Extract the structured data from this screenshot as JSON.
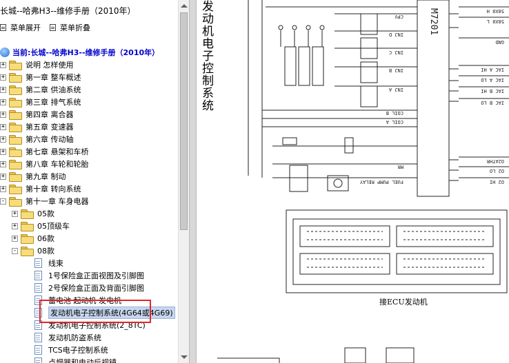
{
  "window": {
    "title": "长城--哈弗H3--维修手册（2010年）"
  },
  "toolbar": {
    "expand_label": "菜单展开",
    "collapse_label": "菜单折叠"
  },
  "tree": {
    "root": "当前:长城--哈弗H3--维修手册（2010年）",
    "items": [
      {
        "label": "说明 怎样使用",
        "expander": "+"
      },
      {
        "label": "第一章 整车概述",
        "expander": "+"
      },
      {
        "label": "第二章 供油系统",
        "expander": "+"
      },
      {
        "label": "第三章 排气系统",
        "expander": "+"
      },
      {
        "label": "第四章 离合器",
        "expander": "+"
      },
      {
        "label": "第五章 变速器",
        "expander": "+"
      },
      {
        "label": "第六章 传动轴",
        "expander": "+"
      },
      {
        "label": "第七章 悬架和车桥",
        "expander": "+"
      },
      {
        "label": "第八章 车轮和轮胎",
        "expander": "+"
      },
      {
        "label": "第九章 制动",
        "expander": "+"
      },
      {
        "label": "第十章 转向系统",
        "expander": "+"
      },
      {
        "label": "第十一章 车身电器",
        "expander": "-"
      }
    ],
    "subfolders": [
      {
        "label": "05款",
        "expander": "+"
      },
      {
        "label": "05顶级车",
        "expander": "+"
      },
      {
        "label": "06款",
        "expander": "+"
      },
      {
        "label": "08款",
        "expander": "-"
      }
    ],
    "docs": [
      {
        "label": "线束"
      },
      {
        "label": "1号保险盒正面视图及引脚图"
      },
      {
        "label": "2号保险盒正面及背面引脚图"
      },
      {
        "label": "蓄电池 起动机 发电机"
      },
      {
        "label": "发动机电子控制系统(4G64或4G69)",
        "selected": true
      },
      {
        "label": "发动机电子控制系统(2_8TC)"
      },
      {
        "label": "发动机防盗系统"
      },
      {
        "label": "TCS电子控制系统"
      },
      {
        "label": "点烟器和电动后视镜"
      }
    ]
  },
  "diagram": {
    "title": "发动机电子控制系统",
    "ecu_caption": "接ECU发动机",
    "chip_label": "M7201",
    "pins": [
      "CPV",
      "INJ D",
      "INJ C",
      "INJ B",
      "INJ A",
      "COIL B",
      "COIL A",
      "MR",
      "FUEL PUMP RELAY"
    ],
    "right_labels": [
      "58X8 H",
      "58X8 L",
      "GND",
      "IAC A HI",
      "IAC A LO",
      "IAC B HI",
      "IAC B LO",
      "O2ATHR",
      "O2 LO",
      "O2 HI"
    ]
  }
}
